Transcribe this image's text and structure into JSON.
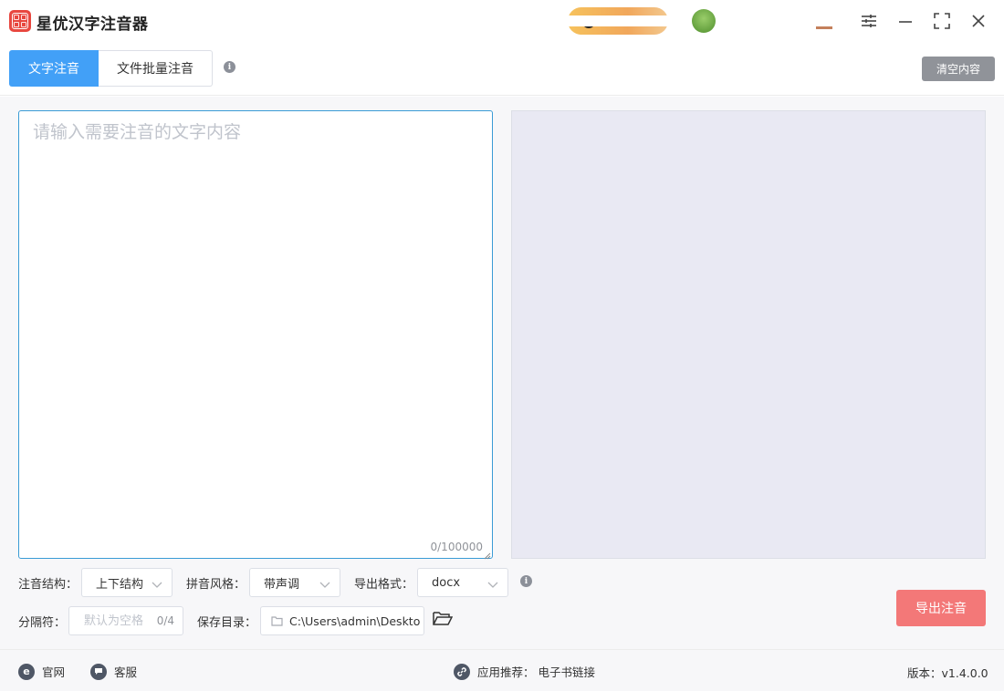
{
  "app": {
    "title": "星优汉字注音器"
  },
  "tabs": [
    {
      "label": "文字注音",
      "active": true
    },
    {
      "label": "文件批量注音",
      "active": false
    }
  ],
  "toolbar": {
    "clear_label": "清空内容"
  },
  "editor": {
    "placeholder": "请输入需要注音的文字内容",
    "value": "",
    "char_count": "0/100000"
  },
  "options": {
    "structure": {
      "label": "注音结构：",
      "value": "上下结构"
    },
    "style": {
      "label": "拼音风格：",
      "value": "带声调"
    },
    "format": {
      "label": "导出格式：",
      "value": "docx"
    },
    "separator": {
      "label": "分隔符：",
      "placeholder": "默认为空格",
      "count": "0/4"
    },
    "save_dir": {
      "label": "保存目录：",
      "value": "C:\\Users\\admin\\Deskto"
    },
    "export_label": "导出注音"
  },
  "footer": {
    "website": "官网",
    "service": "客服",
    "recommend_label": "应用推荐：",
    "recommend_link": "电子书链接",
    "version": "版本：v1.4.0.0"
  },
  "colors": {
    "primary": "#42a0f7",
    "export": "#f37878",
    "clear": "#909399",
    "output_bg": "#e9e9f3"
  },
  "icons": [
    "app-logo",
    "info-icon",
    "settings-sliders-icon",
    "minimize-icon",
    "fullscreen-icon",
    "close-icon",
    "chevron-down-icon",
    "folder-icon",
    "ie-icon",
    "chat-icon",
    "link-icon"
  ]
}
